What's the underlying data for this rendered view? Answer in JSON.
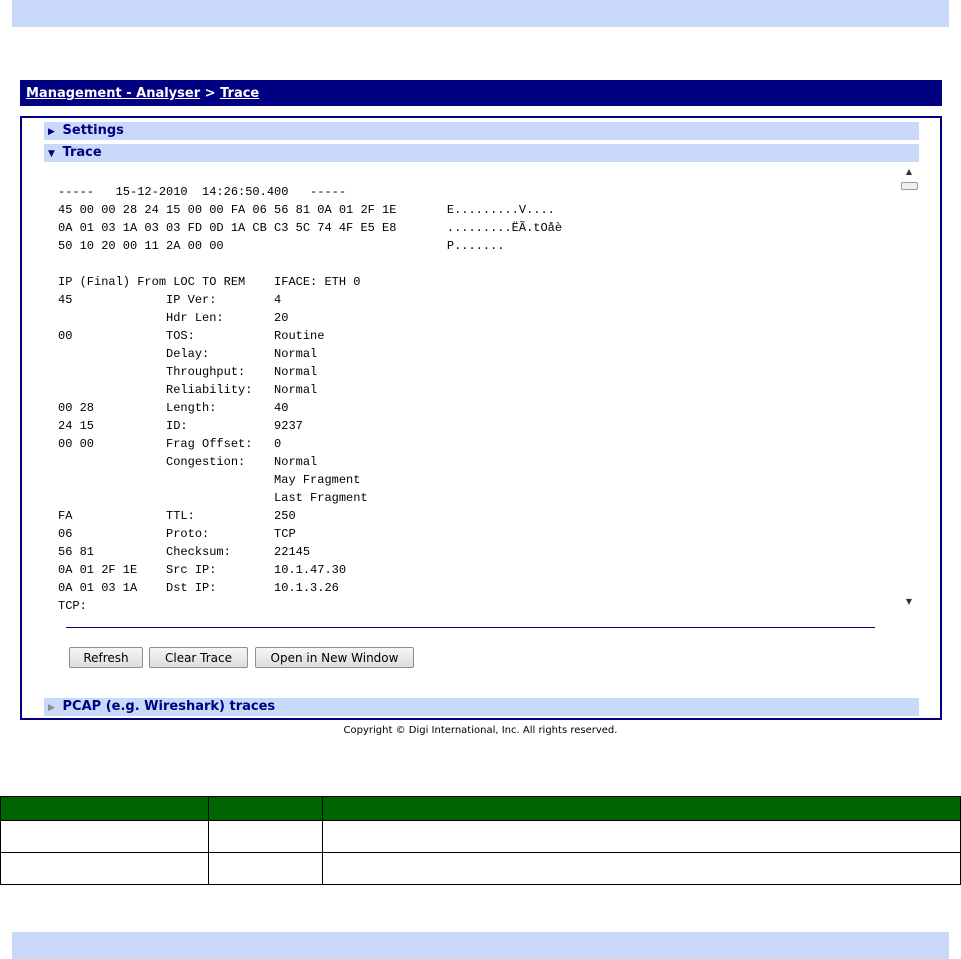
{
  "breadcrumb": {
    "section_link": "Management - Analyser",
    "separator": ">",
    "page_link": "Trace"
  },
  "sections": {
    "settings": "Settings",
    "trace": "Trace",
    "pcap": "PCAP (e.g. Wireshark) traces"
  },
  "trace_lines": [
    "-----   15-12-2010  14:26:50.400   -----",
    "45 00 00 28 24 15 00 00 FA 06 56 81 0A 01 2F 1E       E.........V....",
    "0A 01 03 1A 03 03 FD 0D 1A CB C3 5C 74 4F E5 E8       .........ËÃ.tOåè",
    "50 10 20 00 11 2A 00 00                               P.......",
    "",
    "IP (Final) From LOC TO REM    IFACE: ETH 0",
    "45             IP Ver:        4",
    "               Hdr Len:       20",
    "00             TOS:           Routine",
    "               Delay:         Normal",
    "               Throughput:    Normal",
    "               Reliability:   Normal",
    "00 28          Length:        40",
    "24 15          ID:            9237",
    "00 00          Frag Offset:   0",
    "               Congestion:    Normal",
    "                              May Fragment",
    "                              Last Fragment",
    "FA             TTL:           250",
    "06             Proto:         TCP",
    "56 81          Checksum:      22145",
    "0A 01 2F 1E    Src IP:        10.1.47.30",
    "0A 01 03 1A    Dst IP:        10.1.3.26",
    "TCP:"
  ],
  "buttons": {
    "refresh": "Refresh",
    "clear_trace": "Clear Trace",
    "open_new_window": "Open in New Window"
  },
  "copyright": "Copyright © Digi International, Inc. All rights reserved.",
  "colors": {
    "header_bg": "#000080",
    "section_bar_bg": "#c9d9f9",
    "table_header_bg": "#006400"
  },
  "icons": {
    "section_collapsed": "triangle-right-icon",
    "section_expanded": "triangle-down-icon"
  }
}
